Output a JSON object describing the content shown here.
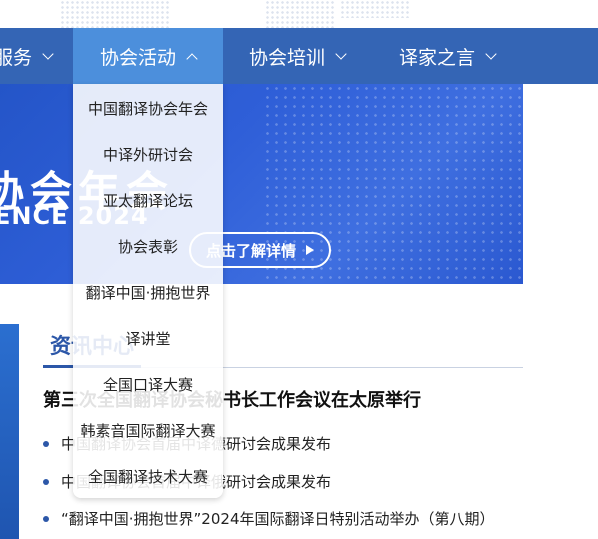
{
  "nav": {
    "items": [
      {
        "label": "服务",
        "state": "collapsed"
      },
      {
        "label": "协会活动",
        "state": "expanded"
      },
      {
        "label": "协会培训",
        "state": "collapsed"
      },
      {
        "label": "译家之言",
        "state": "collapsed"
      }
    ]
  },
  "dropdown": {
    "items": [
      {
        "label": "中国翻译协会年会"
      },
      {
        "label": "中译外研讨会"
      },
      {
        "label": "亚太翻译论坛"
      },
      {
        "label": "协会表彰"
      },
      {
        "label": "翻译中国·拥抱世界"
      },
      {
        "label": "译讲堂"
      },
      {
        "label": "全国口译大赛"
      },
      {
        "label": "韩素音国际翻译大赛"
      },
      {
        "label": "全国翻译技术大赛"
      }
    ]
  },
  "banner": {
    "title": "协会年会",
    "subtitle": "ENCE 2024",
    "details_label": "点击了解详情"
  },
  "news": {
    "section_title": "资讯中心",
    "headline": "第三次全国翻译协会秘书长工作会议在太原举行",
    "items": [
      {
        "text": "中国翻译协会首届中译德研讨会成果发布"
      },
      {
        "text": "中国翻译协会首届中译俄研讨会成果发布"
      },
      {
        "text": "“翻译中国·拥抱世界”2024年国际翻译日特别活动举办（第八期）"
      }
    ]
  },
  "colors": {
    "nav_bg": "#3465b5",
    "nav_active_bg": "#4c8fdc",
    "banner_bg": "#2f5fd8",
    "accent": "#2c57a8"
  }
}
